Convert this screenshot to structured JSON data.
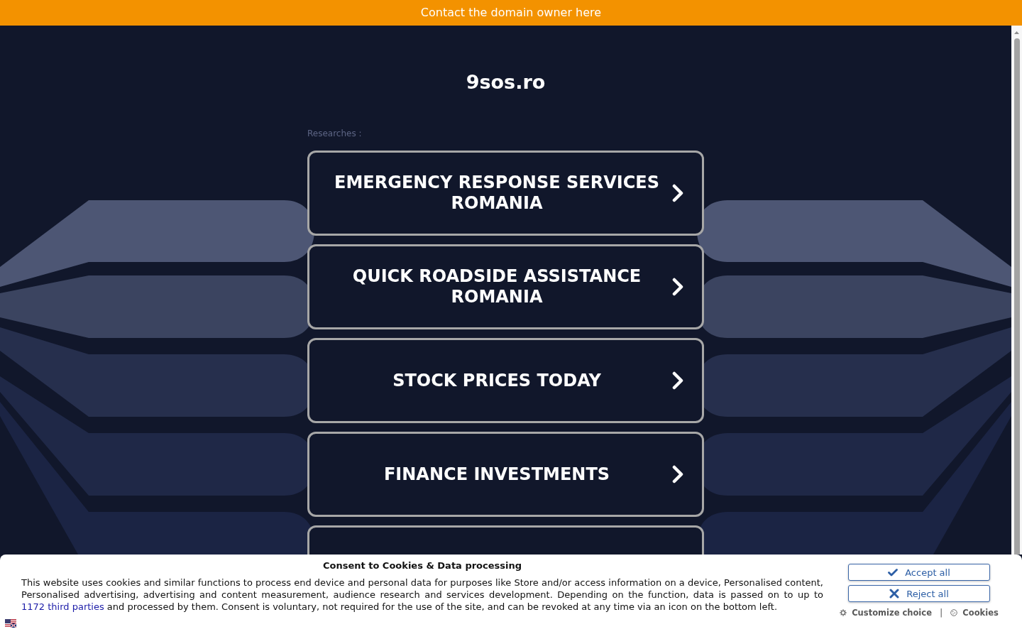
{
  "top_bar": {
    "link": "Contact the domain owner here"
  },
  "header": {
    "title": "9sos.ro",
    "section_label": "Researches :"
  },
  "results": [
    {
      "kind": "labelled",
      "label": "EMERGENCY RESPONSE SERVICES ROMANIA"
    },
    {
      "kind": "labelled",
      "label": "QUICK ROADSIDE ASSISTANCE ROMANIA"
    },
    {
      "kind": "labelled",
      "label": "STOCK PRICES TODAY"
    },
    {
      "kind": "labelled",
      "label": "FINANCE INVESTMENTS"
    },
    {
      "kind": "covered"
    }
  ],
  "cookie_banner": {
    "title": "Consent to Cookies & Data processing",
    "text_before": "This website uses cookies and similar functions to process end device and personal data for purposes like Store and/or access information on a device, Personalised content, Personalised advertising, advertising and content measurement, audience research and services development. Depending on the function, data is passed on to up to",
    "link": "1172 third parties",
    "text_after": "and processed by them. Consent is voluntary, not required for the use of the site, and can be revoked at any time via an icon on the bottom left.",
    "buttons": [
      {
        "kind": "accept",
        "label": "Accept all"
      },
      {
        "kind": "reject",
        "label": "Reject all"
      }
    ],
    "links": [
      {
        "kind": "customize",
        "label": "Customize choice"
      },
      {
        "kind": "cookies",
        "label": "Cookies"
      }
    ],
    "separator": "|"
  }
}
